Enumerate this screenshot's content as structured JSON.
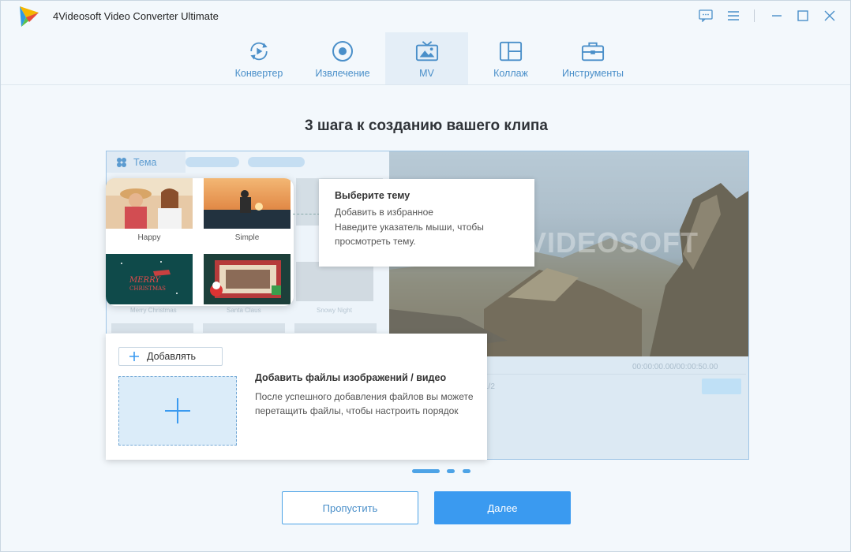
{
  "app": {
    "title": "4Videosoft Video Converter Ultimate"
  },
  "nav": {
    "tabs": [
      {
        "label": "Конвертер",
        "icon": "converter-icon"
      },
      {
        "label": "Извлечение",
        "icon": "extract-icon"
      },
      {
        "label": "MV",
        "icon": "mv-icon",
        "active": true
      },
      {
        "label": "Коллаж",
        "icon": "collage-icon"
      },
      {
        "label": "Инструменты",
        "icon": "toolbox-icon"
      }
    ]
  },
  "main": {
    "title": "3 шага к созданию вашего клипа"
  },
  "demo": {
    "theme_tab_label": "Тема",
    "themes": [
      {
        "label": "Happy"
      },
      {
        "label": "Simple"
      }
    ],
    "faded_theme_labels": [
      "Merry Christmas",
      "Santa Claus",
      "Snowy Night"
    ],
    "watermark": "VIDEOSOFT",
    "time_readout": "00:00:00.00/00:00:50.00",
    "page_readout": "1/2",
    "tooltip": {
      "title": "Выберите тему",
      "line1": "Добавить в избранное",
      "line2": "Наведите указатель мыши, чтобы просмотреть тему."
    },
    "add_card": {
      "add_button": "Добавлять",
      "title": "Добавить файлы изображений / видео",
      "desc": "После успешного добавления файлов вы можете перетащить файлы, чтобы настроить порядок"
    }
  },
  "pager": {
    "total": 3,
    "current": 1
  },
  "buttons": {
    "skip": "Пропустить",
    "next": "Далее"
  },
  "colors": {
    "accent": "#3a9af0",
    "tab_text": "#4a8fc9"
  }
}
